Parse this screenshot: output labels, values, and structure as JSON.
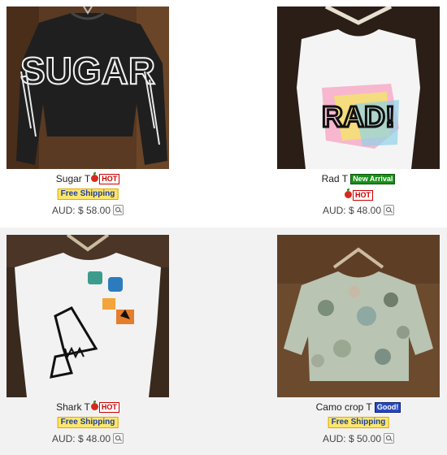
{
  "products": [
    {
      "name": "Sugar T",
      "badges": [
        "HOT"
      ],
      "free_shipping": "Free Shipping",
      "price": "AUD: $ 58.00",
      "shirt_print": "SUGAR",
      "image_icon": "black-sugar-crop-tee-photo"
    },
    {
      "name": "Rad T",
      "badges": [
        "New Arrival",
        "HOT"
      ],
      "price": "AUD: $ 48.00",
      "shirt_print": "RAD!",
      "image_icon": "white-rad-crop-tank-photo"
    },
    {
      "name": "Shark T",
      "badges": [
        "HOT"
      ],
      "free_shipping": "Free Shipping",
      "price": "AUD: $ 48.00",
      "image_icon": "white-shark-crop-tank-photo"
    },
    {
      "name": "Camo crop T",
      "badges": [
        "Good!"
      ],
      "free_shipping": "Free Shipping",
      "price": "AUD: $ 50.00",
      "image_icon": "camo-crop-tee-photo"
    }
  ],
  "colors": {
    "hot_badge": "#cc0000",
    "new_arrival_badge": "#1b8d1b",
    "good_badge": "#2649c4",
    "free_shipping_bg": "#ffe66b",
    "free_shipping_text": "#1a3fa0"
  }
}
